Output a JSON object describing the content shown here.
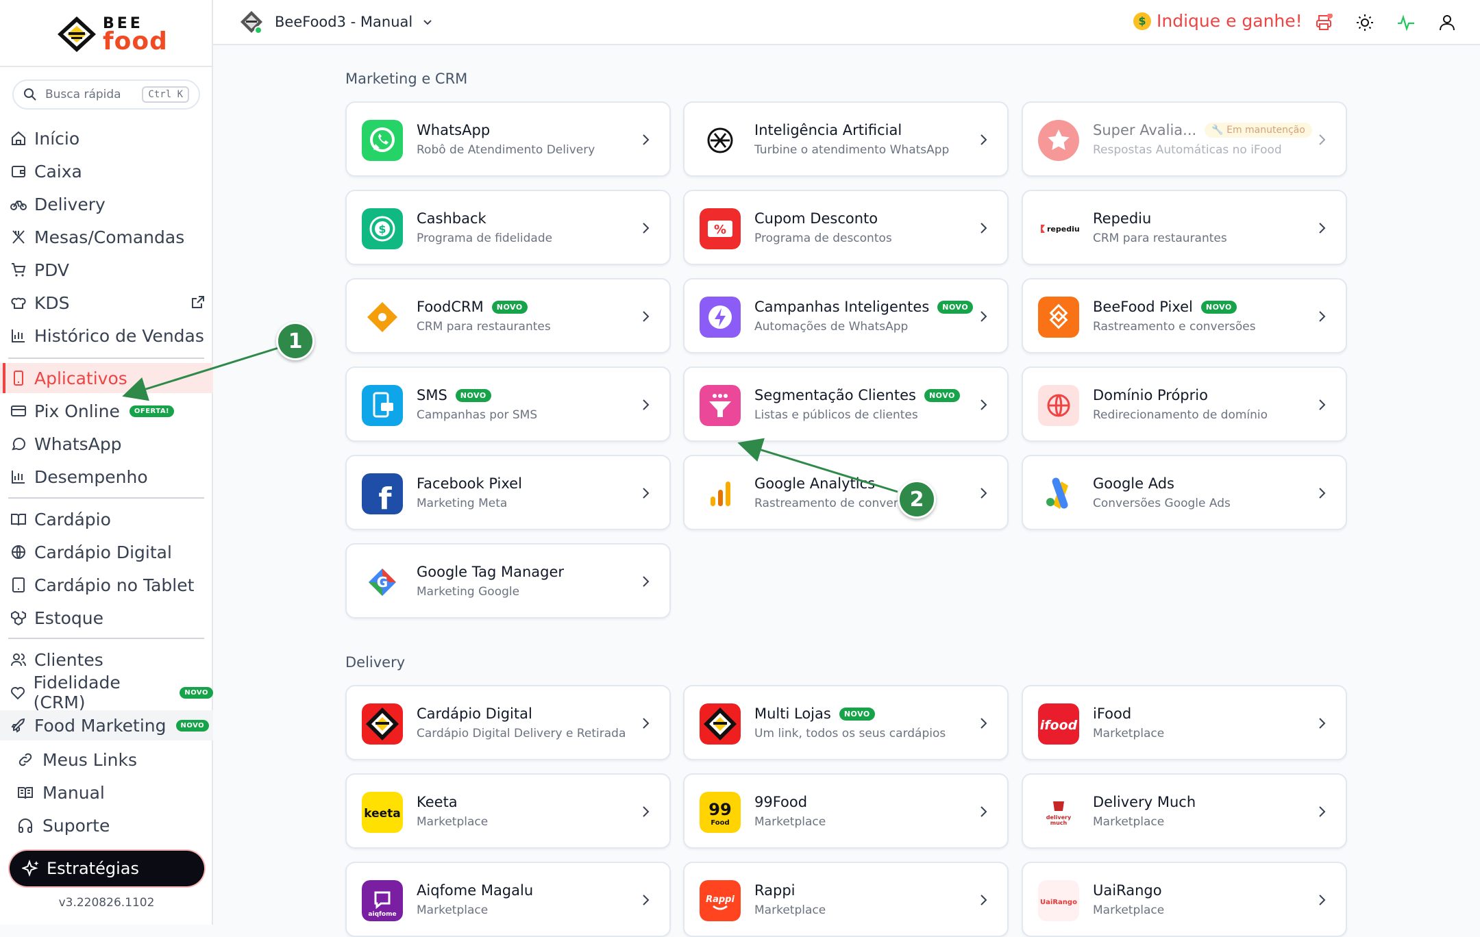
{
  "app": {
    "logo_top": "BEE",
    "logo_bottom": "food",
    "version": "v3.220826.1102"
  },
  "search": {
    "placeholder": "Busca rápida",
    "shortcut": "Ctrl K"
  },
  "sidebar": {
    "items": [
      {
        "label": "Início",
        "icon": "home-icon"
      },
      {
        "label": "Caixa",
        "icon": "wallet-icon"
      },
      {
        "label": "Delivery",
        "icon": "bike-icon"
      },
      {
        "label": "Mesas/Comandas",
        "icon": "utensils-icon"
      },
      {
        "label": "PDV",
        "icon": "cart-icon"
      },
      {
        "label": "KDS",
        "icon": "chef-hat-icon"
      },
      {
        "label": "Histórico de Vendas",
        "icon": "bar-chart-icon"
      },
      {
        "label": "Aplicativos",
        "icon": "smartphone-icon",
        "active": true
      },
      {
        "label": "Pix Online",
        "icon": "card-icon",
        "badge": "OFERTA!"
      },
      {
        "label": "WhatsApp",
        "icon": "chat-icon"
      },
      {
        "label": "Desempenho",
        "icon": "bar-chart-icon"
      },
      {
        "label": "Cardápio",
        "icon": "book-icon"
      },
      {
        "label": "Cardápio Digital",
        "icon": "globe-icon"
      },
      {
        "label": "Cardápio no Tablet",
        "icon": "tablet-icon"
      },
      {
        "label": "Estoque",
        "icon": "boxes-icon"
      },
      {
        "label": "Clientes",
        "icon": "users-icon"
      },
      {
        "label": "Fidelidade (CRM)",
        "icon": "heart-icon",
        "badge": "NOVO"
      },
      {
        "label": "Food Marketing",
        "icon": "rocket-icon",
        "badge": "NOVO"
      },
      {
        "label": "Meus Links",
        "icon": "link-icon"
      },
      {
        "label": "Manual",
        "icon": "open-book-icon"
      },
      {
        "label": "Suporte",
        "icon": "headphones-icon"
      }
    ],
    "cta": "Estratégias"
  },
  "topbar": {
    "store": "BeeFood3 - Manual",
    "promo": "Indique e ganhe!",
    "promo_emoji": "$"
  },
  "sections": [
    {
      "title": "Marketing e CRM",
      "cards": [
        {
          "title": "WhatsApp",
          "subtitle": "Robô de Atendimento Delivery",
          "color": "#25d366"
        },
        {
          "title": "Inteligência Artificial",
          "subtitle": "Turbine o atendimento WhatsApp",
          "color": "#ffffff"
        },
        {
          "title": "Super Avalia...",
          "subtitle": "Respostas Automáticas no iFood",
          "status": "Em manutenção",
          "color": "#ef4444"
        },
        {
          "title": "Cashback",
          "subtitle": "Programa de fidelidade",
          "color": "#10b981"
        },
        {
          "title": "Cupom Desconto",
          "subtitle": "Programa de descontos",
          "color": "#ef2b2b"
        },
        {
          "title": "Repediu",
          "subtitle": "CRM para restaurantes",
          "logo_text": "repediu",
          "color": "#ffffff"
        },
        {
          "title": "FoodCRM",
          "badge": "NOVO",
          "subtitle": "CRM para restaurantes",
          "color": "#facc15"
        },
        {
          "title": "Campanhas Inteligentes",
          "badge": "NOVO",
          "subtitle": "Automações de WhatsApp",
          "color": "#8b5cf6"
        },
        {
          "title": "BeeFood Pixel",
          "badge": "NOVO",
          "subtitle": "Rastreamento e conversões",
          "color": "#f97316"
        },
        {
          "title": "SMS",
          "badge": "NOVO",
          "subtitle": "Campanhas por SMS",
          "color": "#0ea5e9"
        },
        {
          "title": "Segmentação Clientes",
          "badge": "NOVO",
          "subtitle": "Listas e públicos de clientes",
          "color": "#ec4899"
        },
        {
          "title": "Domínio Próprio",
          "subtitle": "Redirecionamento de domínio",
          "color": "#fee2e2"
        },
        {
          "title": "Facebook Pixel",
          "subtitle": "Marketing Meta",
          "logo_text": "f",
          "color": "#1e4ea8"
        },
        {
          "title": "Google Analytics",
          "subtitle": "Rastreamento de conversões",
          "color": "#ffffff"
        },
        {
          "title": "Google Ads",
          "subtitle": "Conversões Google Ads",
          "color": "#ffffff"
        },
        {
          "title": "Google Tag Manager",
          "subtitle": "Marketing Google",
          "logo_text": "G",
          "color": "#ffffff"
        }
      ]
    },
    {
      "title": "Delivery",
      "cards": [
        {
          "title": "Cardápio Digital",
          "subtitle": "Cardápio Digital Delivery e Retirada",
          "color": "#ef1f1f"
        },
        {
          "title": "Multi Lojas",
          "badge": "NOVO",
          "subtitle": "Um link, todos os seus cardápios",
          "color": "#ef1f1f"
        },
        {
          "title": "iFood",
          "subtitle": "Marketplace",
          "logo_text": "ifood",
          "color": "#ea1d2c"
        },
        {
          "title": "Keeta",
          "subtitle": "Marketplace",
          "logo_text": "keeta",
          "color": "#ffe000"
        },
        {
          "title": "99Food",
          "subtitle": "Marketplace",
          "logo_text": "99",
          "color": "#ffd400"
        },
        {
          "title": "Delivery Much",
          "subtitle": "Marketplace",
          "logo_text": "delivery much",
          "color": "#ffffff"
        },
        {
          "title": "Aiqfome Magalu",
          "subtitle": "Marketplace",
          "logo_text": "aiqfome",
          "color": "#7b1fa2"
        },
        {
          "title": "Rappi",
          "subtitle": "Marketplace",
          "logo_text": "Rappi",
          "color": "#ff441f"
        },
        {
          "title": "UaiRango",
          "subtitle": "Marketplace",
          "logo_text": "UaiRango",
          "color": "#fff1f1"
        }
      ]
    }
  ],
  "annotations": [
    {
      "label": "1"
    },
    {
      "label": "2"
    }
  ]
}
